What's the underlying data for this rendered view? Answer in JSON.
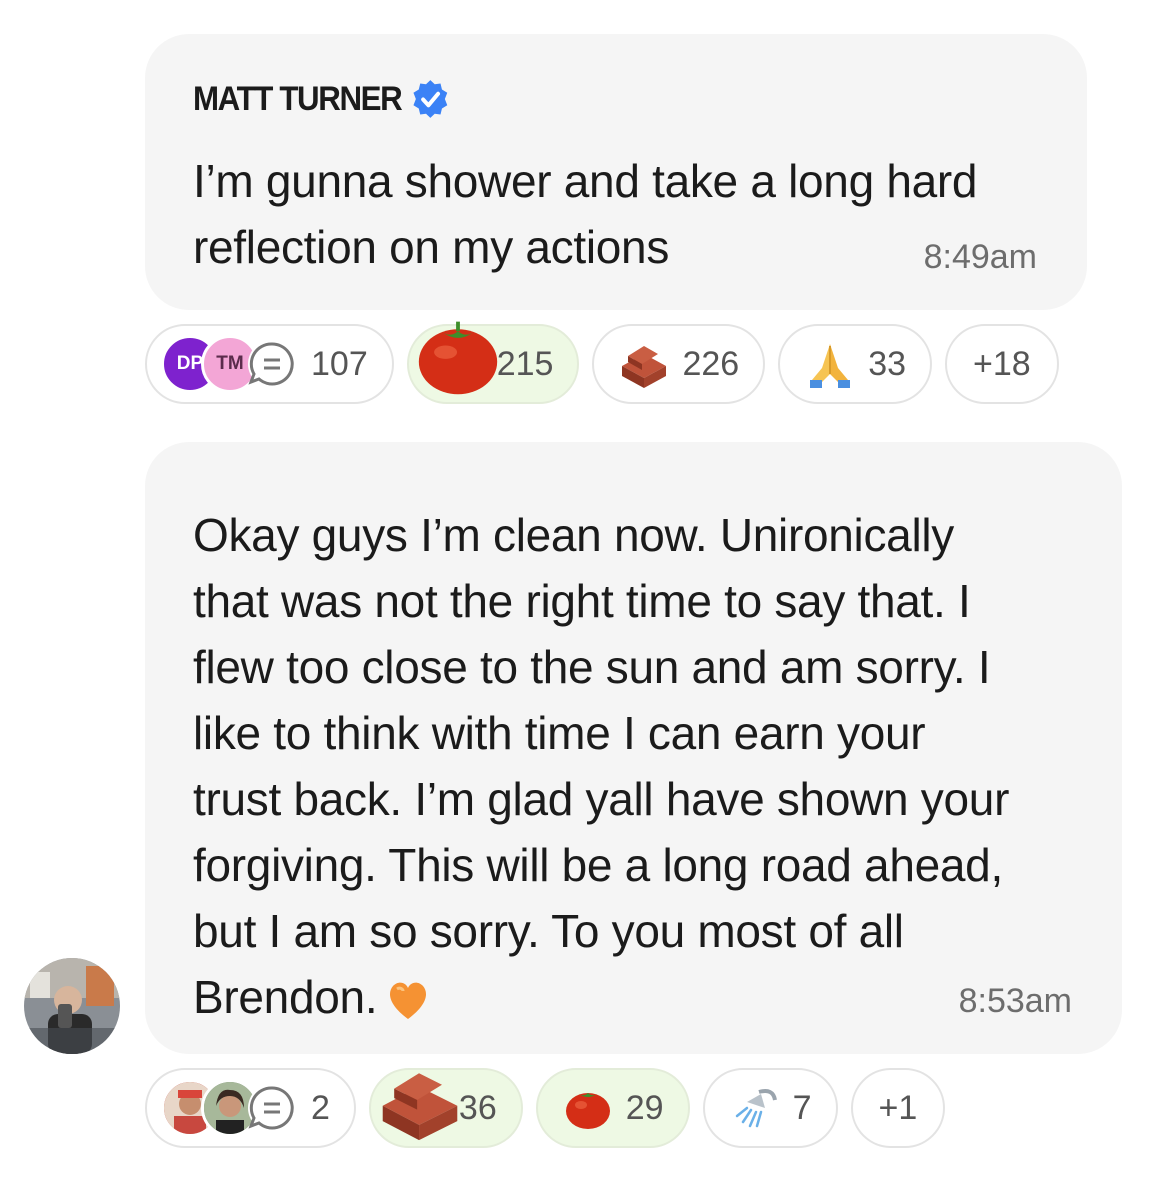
{
  "post1": {
    "author": "MATT TURNER",
    "text": "I’m gunna shower and take a long hard\nreflection on my actions",
    "time": "8:49am",
    "reactions": {
      "avatar1": "DP",
      "avatar2": "TM",
      "comments": "107",
      "tomato": "215",
      "brick": "226",
      "pray": "33",
      "more": "+18"
    }
  },
  "post2": {
    "text": "Okay guys I’m clean now. Unironically\nthat was not the right time to say that. I\nflew too close to the sun and am sorry. I\nlike to think with time I can earn your\ntrust back. I’m glad yall have shown your\nforgiving. This will be a long road ahead,\nbut I am so sorry. To you most of all\nBrendon.",
    "time": "8:53am",
    "reactions": {
      "comments": "2",
      "brick": "36",
      "tomato": "29",
      "shower": "7",
      "more": "+1"
    }
  },
  "colors": {
    "bubble": "#f5f5f5",
    "verified": "#3b82f6",
    "active_pill": "#eef9e4",
    "avatar_dp": "#7e22ce",
    "avatar_tm": "#f3a6d6"
  },
  "icons": [
    "verified-badge-icon",
    "comment-icon",
    "tomato-emoji-icon",
    "brick-emoji-icon",
    "pray-emoji-icon",
    "shower-emoji-icon",
    "orange-heart-icon"
  ]
}
